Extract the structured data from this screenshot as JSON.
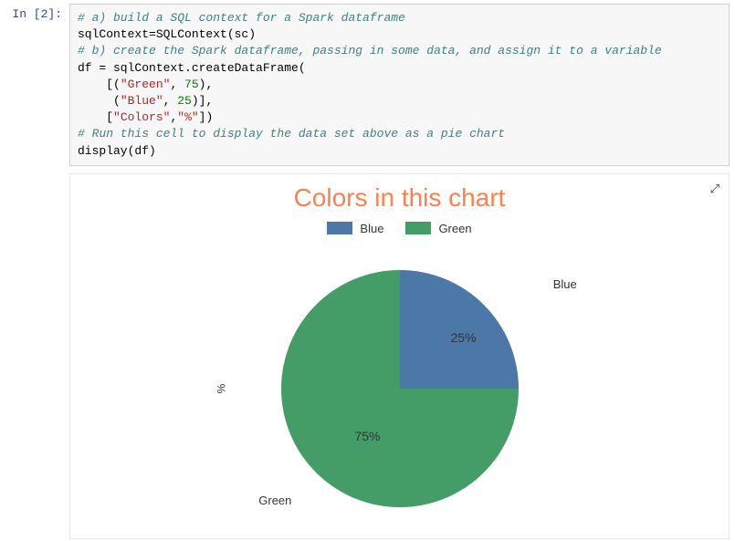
{
  "cell": {
    "prompt": "In [2]:",
    "code_html": "<span class=\"c\"># a) build a SQL context for a Spark dataframe</span>\n<span class=\"n\">sqlContext=SQLContext(sc)</span>\n<span class=\"c\"># b) create the Spark dataframe, passing in some data, and assign it to a variable</span>\n<span class=\"n\">df = sqlContext.createDataFrame(</span>\n    <span class=\"n\">[(</span><span class=\"s\">\"Green\"</span><span class=\"n\">, </span><span class=\"m\">75</span><span class=\"n\">),</span>\n     <span class=\"n\">(</span><span class=\"s\">\"Blue\"</span><span class=\"n\">, </span><span class=\"m\">25</span><span class=\"n\">)],</span>\n    <span class=\"n\">[</span><span class=\"s\">\"Colors\"</span><span class=\"n\">,</span><span class=\"s\">\"%\"</span><span class=\"n\">])</span>\n<span class=\"c\"># Run this cell to display the data set above as a pie chart</span>\n<span class=\"n\">display(df)</span>"
  },
  "chart": {
    "title": "Colors in this chart",
    "ylabel": "%",
    "legend": [
      {
        "name": "Blue",
        "color": "#4C78A8"
      },
      {
        "name": "Green",
        "color": "#449D67"
      }
    ],
    "slice_blue": {
      "pct": "25%",
      "name": "Blue"
    },
    "slice_green": {
      "pct": "75%",
      "name": "Green"
    }
  },
  "icons": {
    "expand": "⤢"
  },
  "chart_data": {
    "type": "pie",
    "title": "Colors in this chart",
    "ylabel": "%",
    "categories": [
      "Blue",
      "Green"
    ],
    "values": [
      25,
      75
    ],
    "series": [
      {
        "name": "Blue",
        "value": 25,
        "color": "#4C78A8"
      },
      {
        "name": "Green",
        "value": 75,
        "color": "#449D67"
      }
    ],
    "legend_position": "top"
  }
}
